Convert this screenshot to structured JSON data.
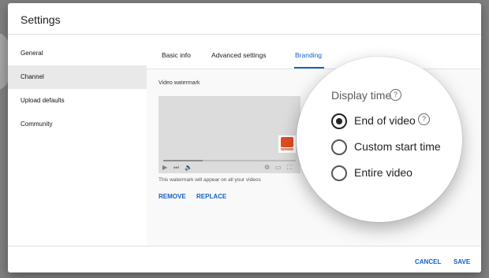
{
  "dialog": {
    "title": "Settings"
  },
  "sidebar": {
    "items": [
      {
        "label": "General"
      },
      {
        "label": "Channel"
      },
      {
        "label": "Upload defaults"
      },
      {
        "label": "Community"
      }
    ]
  },
  "tabs": [
    {
      "label": "Basic info"
    },
    {
      "label": "Advanced settings"
    },
    {
      "label": "Branding"
    }
  ],
  "watermark": {
    "section_title": "Video watermark",
    "note": "This watermark will appear on all your videos",
    "remove_label": "REMOVE",
    "replace_label": "REPLACE",
    "progress_fraction": 0.3
  },
  "zoom": {
    "title": "Display time",
    "help_glyph": "?",
    "options": [
      {
        "label": "End of video",
        "selected": true
      },
      {
        "label": "Custom start time",
        "selected": false
      },
      {
        "label": "Entire video",
        "selected": false
      }
    ]
  },
  "footer": {
    "cancel_label": "CANCEL",
    "save_label": "SAVE"
  },
  "colors": {
    "accent": "#1461c4",
    "watermark_logo": "#e04e24"
  }
}
